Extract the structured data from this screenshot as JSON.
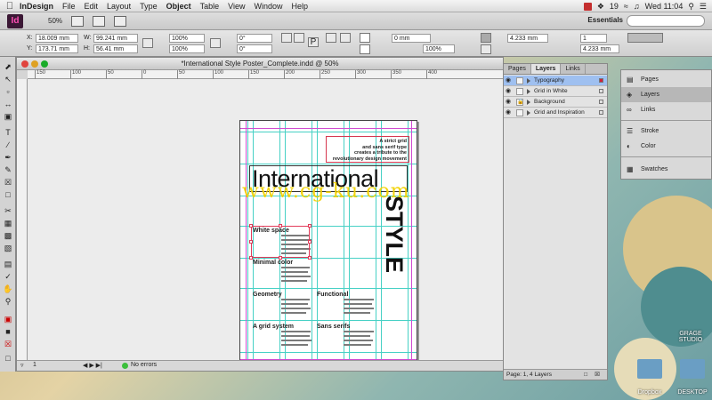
{
  "menubar": {
    "app_name": "InDesign",
    "menus": [
      "File",
      "Edit",
      "Layout",
      "Type",
      "Object",
      "Table",
      "View",
      "Window",
      "Help"
    ],
    "battery_badge": "19",
    "clock": "Wed 11:04"
  },
  "appbar": {
    "logo": "Id",
    "zoom": "50%",
    "workspace": "Essentials"
  },
  "control": {
    "x_label": "X:",
    "x_value": "18.009 mm",
    "y_label": "Y:",
    "y_value": "173.71 mm",
    "w_label": "W:",
    "w_value": "99.241 mm",
    "h_label": "H:",
    "h_value": "56.41 mm",
    "scale_x": "100%",
    "scale_y": "100%",
    "rotate": "0°",
    "shear": "0°",
    "stroke_weight": "0 mm",
    "stroke_pct": "100%",
    "width2": "4.233 mm",
    "height2": "4.233 mm",
    "cols": "1"
  },
  "document": {
    "title": "*International Style Poster_Complete.indd @ 50%",
    "ruler_ticks": [
      "150",
      "100",
      "50",
      "0",
      "50",
      "100",
      "150",
      "200",
      "250",
      "300",
      "350",
      "400"
    ],
    "page_number": "1",
    "preflight": "No errors"
  },
  "poster": {
    "intro_lines": [
      "A strict grid",
      "and sans serif type",
      "creates a tribute to the",
      "revolutionary design movement"
    ],
    "title": "International",
    "vertical_title": "STYLE",
    "sections": [
      "White space",
      "Minimal color",
      "Geometry",
      "Functional",
      "A grid system",
      "Sans serifs"
    ]
  },
  "watermark": "www.cg-ku.com",
  "layers_panel": {
    "tabs": [
      "Pages",
      "Layers",
      "Links"
    ],
    "layers": [
      {
        "name": "Typography",
        "color": "#d0203a"
      },
      {
        "name": "Grid in White",
        "color": "#e0e0e0"
      },
      {
        "name": "Background",
        "color": "#e0e0e0"
      },
      {
        "name": "Grid and Inspiration",
        "color": "#e0e0e0"
      }
    ],
    "footer": "Page: 1, 4 Layers"
  },
  "dock": {
    "items": [
      "Pages",
      "Layers",
      "Links",
      "Stroke",
      "Color",
      "Swatches"
    ]
  },
  "desktop": {
    "icons": [
      "Dropbox",
      "DESKTOP"
    ],
    "studio_label": "GRAGE STUDIO"
  }
}
